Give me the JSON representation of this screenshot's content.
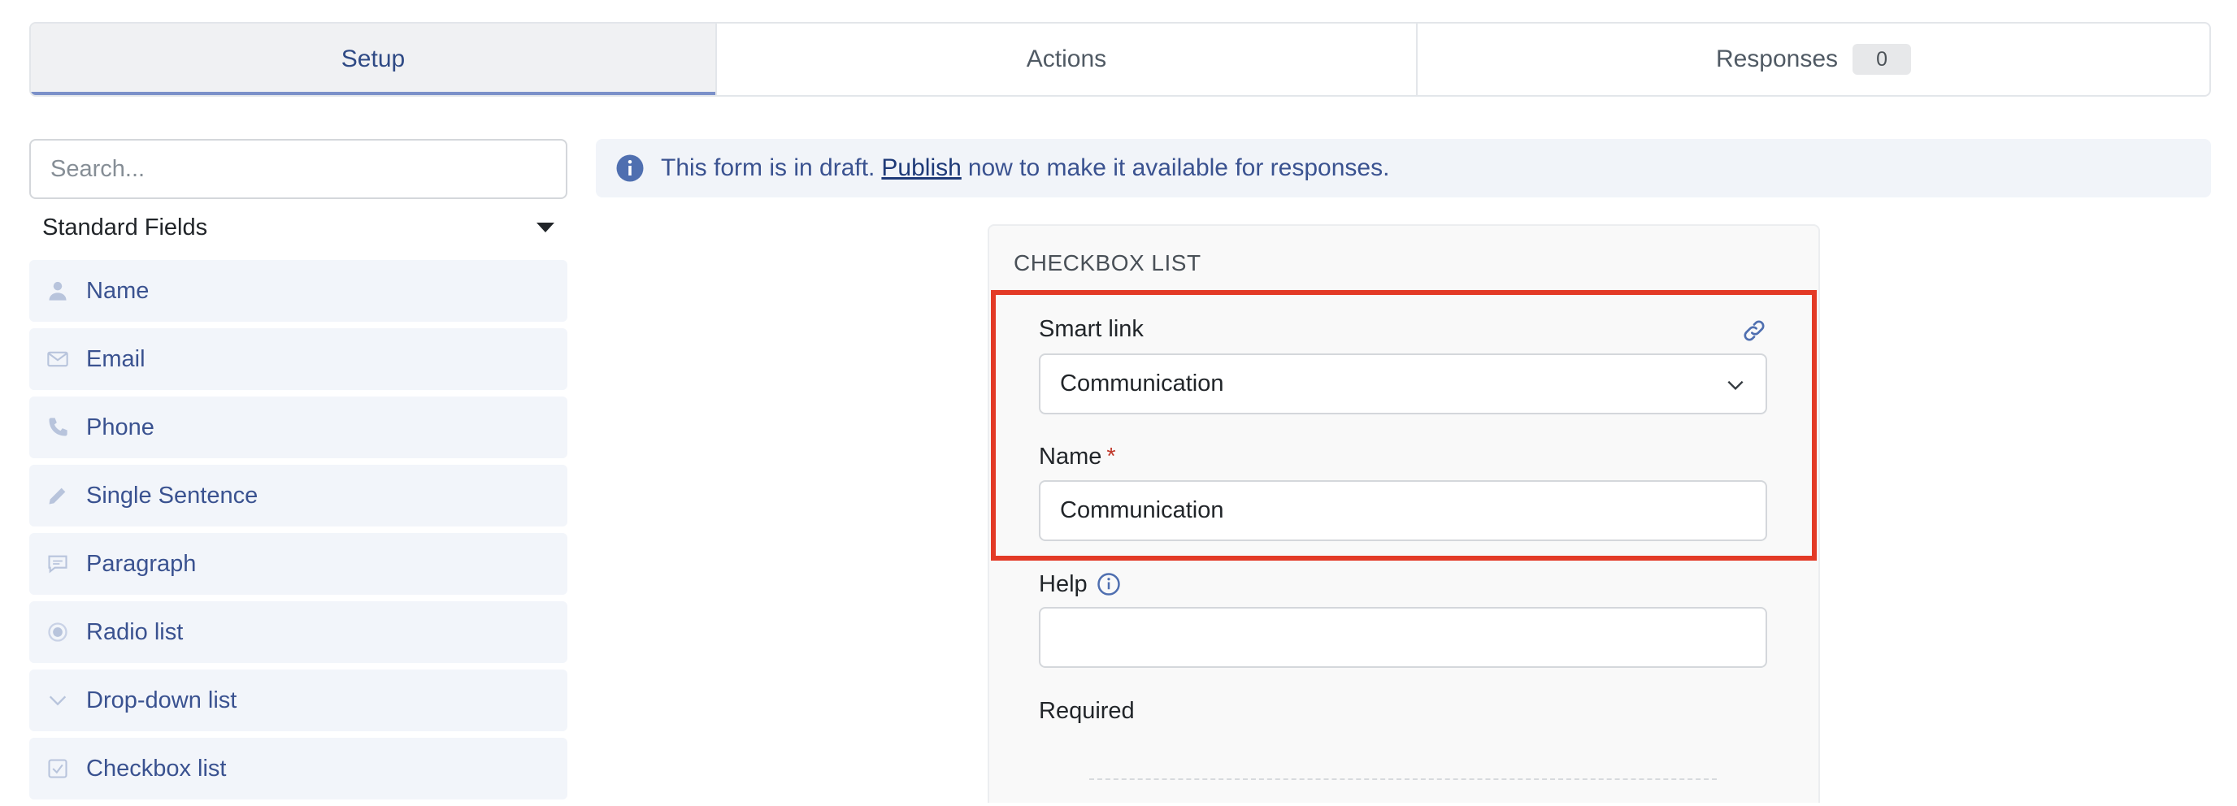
{
  "tabs": {
    "setup": "Setup",
    "actions": "Actions",
    "responses": "Responses",
    "responses_count": "0"
  },
  "sidebar": {
    "search_placeholder": "Search...",
    "section_title": "Standard Fields",
    "items": [
      {
        "label": "Name",
        "icon": "person-icon"
      },
      {
        "label": "Email",
        "icon": "envelope-icon"
      },
      {
        "label": "Phone",
        "icon": "phone-icon"
      },
      {
        "label": "Single Sentence",
        "icon": "pencil-icon"
      },
      {
        "label": "Paragraph",
        "icon": "speech-bubble-icon"
      },
      {
        "label": "Radio list",
        "icon": "radio-icon"
      },
      {
        "label": "Drop-down list",
        "icon": "chevron-down-icon"
      },
      {
        "label": "Checkbox list",
        "icon": "checkbox-icon"
      }
    ]
  },
  "banner": {
    "text_before": "This form is in draft.",
    "link": "Publish",
    "text_after": "now to make it available for responses."
  },
  "panel": {
    "title": "CHECKBOX LIST",
    "smart_link_label": "Smart link",
    "smart_link_value": "Communication",
    "name_label": "Name",
    "required_mark": "*",
    "name_value": "Communication",
    "help_label": "Help",
    "help_value": "",
    "required_label": "Required"
  },
  "colors": {
    "accent": "#3a5290",
    "highlight": "#e33a26",
    "tab_underline": "#7b90c9"
  }
}
